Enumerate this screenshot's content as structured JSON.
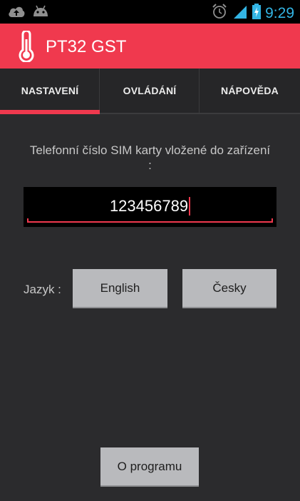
{
  "status_bar": {
    "time": "9:29",
    "icons": [
      "cloud-upload-icon",
      "android-icon",
      "alarm-icon",
      "signal-icon",
      "battery-charging-icon"
    ],
    "accent_color": "#33b5e5"
  },
  "action_bar": {
    "title": "PT32 GST",
    "icon": "thermometer-icon",
    "color": "#f0394e"
  },
  "tabs": [
    {
      "label": "NASTAVENÍ",
      "active": true
    },
    {
      "label": "OVLÁDÁNÍ",
      "active": false
    },
    {
      "label": "NÁPOVĚDA",
      "active": false
    }
  ],
  "settings": {
    "phone_prompt": "Telefonní číslo SIM karty vložené do zařízení :",
    "phone_value": "123456789",
    "language_label": "Jazyk :",
    "english_button": "English",
    "czech_button": "Česky",
    "about_button": "O programu"
  }
}
